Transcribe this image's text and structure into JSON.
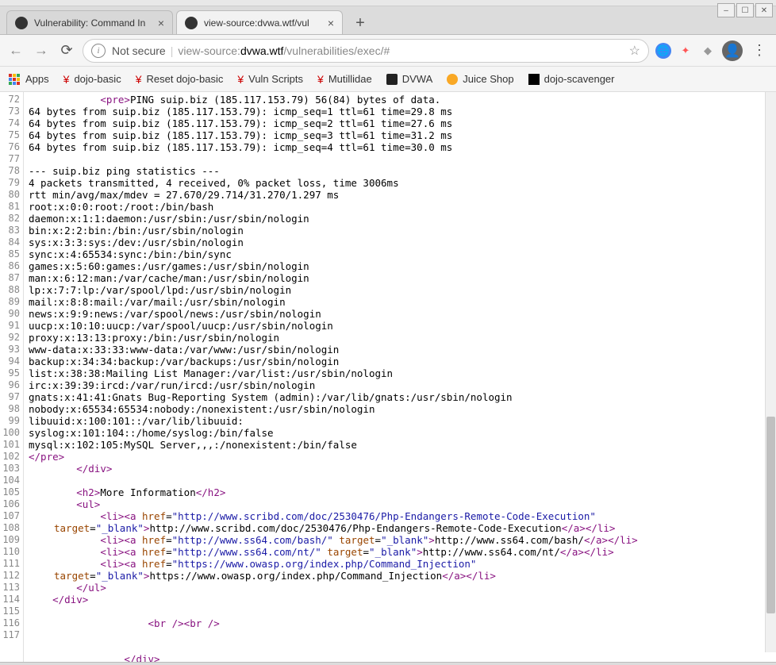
{
  "window": {
    "minimize": "–",
    "maximize": "☐",
    "close": "✕"
  },
  "tabs": {
    "tab1": "Vulnerability: Command In",
    "tab2": "view-source:dvwa.wtf/vul",
    "plus": "+"
  },
  "toolbar": {
    "not_secure": "Not secure",
    "url_prefix": "view-source:",
    "url_host": "dvwa.wtf",
    "url_path": "/vulnerabilities/exec/#"
  },
  "bookmarks": {
    "apps": "Apps",
    "dojo_basic": "dojo-basic",
    "reset_dojo": "Reset dojo-basic",
    "vuln_scripts": "Vuln Scripts",
    "mutillidae": "Mutillidae",
    "dvwa": "DVWA",
    "juice": "Juice Shop",
    "scavenger": "dojo-scavenger"
  },
  "lines": [
    {
      "n": "72",
      "indent": "            ",
      "parts": [
        {
          "k": "t",
          "v": "<pre>"
        },
        {
          "k": "x",
          "v": "PING suip.biz (185.117.153.79) 56(84) bytes of data."
        }
      ]
    },
    {
      "n": "73",
      "indent": "",
      "parts": [
        {
          "k": "x",
          "v": "64 bytes from suip.biz (185.117.153.79): icmp_seq=1 ttl=61 time=29.8 ms"
        }
      ]
    },
    {
      "n": "74",
      "indent": "",
      "parts": [
        {
          "k": "x",
          "v": "64 bytes from suip.biz (185.117.153.79): icmp_seq=2 ttl=61 time=27.6 ms"
        }
      ]
    },
    {
      "n": "75",
      "indent": "",
      "parts": [
        {
          "k": "x",
          "v": "64 bytes from suip.biz (185.117.153.79): icmp_seq=3 ttl=61 time=31.2 ms"
        }
      ]
    },
    {
      "n": "76",
      "indent": "",
      "parts": [
        {
          "k": "x",
          "v": "64 bytes from suip.biz (185.117.153.79): icmp_seq=4 ttl=61 time=30.0 ms"
        }
      ]
    },
    {
      "n": "77",
      "indent": "",
      "parts": []
    },
    {
      "n": "78",
      "indent": "",
      "parts": [
        {
          "k": "x",
          "v": "--- suip.biz ping statistics ---"
        }
      ]
    },
    {
      "n": "79",
      "indent": "",
      "parts": [
        {
          "k": "x",
          "v": "4 packets transmitted, 4 received, 0% packet loss, time 3006ms"
        }
      ]
    },
    {
      "n": "80",
      "indent": "",
      "parts": [
        {
          "k": "x",
          "v": "rtt min/avg/max/mdev = 27.670/29.714/31.270/1.297 ms"
        }
      ]
    },
    {
      "n": "81",
      "indent": "",
      "parts": [
        {
          "k": "x",
          "v": "root:x:0:0:root:/root:/bin/bash"
        }
      ]
    },
    {
      "n": "82",
      "indent": "",
      "parts": [
        {
          "k": "x",
          "v": "daemon:x:1:1:daemon:/usr/sbin:/usr/sbin/nologin"
        }
      ]
    },
    {
      "n": "83",
      "indent": "",
      "parts": [
        {
          "k": "x",
          "v": "bin:x:2:2:bin:/bin:/usr/sbin/nologin"
        }
      ]
    },
    {
      "n": "84",
      "indent": "",
      "parts": [
        {
          "k": "x",
          "v": "sys:x:3:3:sys:/dev:/usr/sbin/nologin"
        }
      ]
    },
    {
      "n": "85",
      "indent": "",
      "parts": [
        {
          "k": "x",
          "v": "sync:x:4:65534:sync:/bin:/bin/sync"
        }
      ]
    },
    {
      "n": "86",
      "indent": "",
      "parts": [
        {
          "k": "x",
          "v": "games:x:5:60:games:/usr/games:/usr/sbin/nologin"
        }
      ]
    },
    {
      "n": "87",
      "indent": "",
      "parts": [
        {
          "k": "x",
          "v": "man:x:6:12:man:/var/cache/man:/usr/sbin/nologin"
        }
      ]
    },
    {
      "n": "88",
      "indent": "",
      "parts": [
        {
          "k": "x",
          "v": "lp:x:7:7:lp:/var/spool/lpd:/usr/sbin/nologin"
        }
      ]
    },
    {
      "n": "89",
      "indent": "",
      "parts": [
        {
          "k": "x",
          "v": "mail:x:8:8:mail:/var/mail:/usr/sbin/nologin"
        }
      ]
    },
    {
      "n": "90",
      "indent": "",
      "parts": [
        {
          "k": "x",
          "v": "news:x:9:9:news:/var/spool/news:/usr/sbin/nologin"
        }
      ]
    },
    {
      "n": "91",
      "indent": "",
      "parts": [
        {
          "k": "x",
          "v": "uucp:x:10:10:uucp:/var/spool/uucp:/usr/sbin/nologin"
        }
      ]
    },
    {
      "n": "92",
      "indent": "",
      "parts": [
        {
          "k": "x",
          "v": "proxy:x:13:13:proxy:/bin:/usr/sbin/nologin"
        }
      ]
    },
    {
      "n": "93",
      "indent": "",
      "parts": [
        {
          "k": "x",
          "v": "www-data:x:33:33:www-data:/var/www:/usr/sbin/nologin"
        }
      ]
    },
    {
      "n": "94",
      "indent": "",
      "parts": [
        {
          "k": "x",
          "v": "backup:x:34:34:backup:/var/backups:/usr/sbin/nologin"
        }
      ]
    },
    {
      "n": "95",
      "indent": "",
      "parts": [
        {
          "k": "x",
          "v": "list:x:38:38:Mailing List Manager:/var/list:/usr/sbin/nologin"
        }
      ]
    },
    {
      "n": "96",
      "indent": "",
      "parts": [
        {
          "k": "x",
          "v": "irc:x:39:39:ircd:/var/run/ircd:/usr/sbin/nologin"
        }
      ]
    },
    {
      "n": "97",
      "indent": "",
      "parts": [
        {
          "k": "x",
          "v": "gnats:x:41:41:Gnats Bug-Reporting System (admin):/var/lib/gnats:/usr/sbin/nologin"
        }
      ]
    },
    {
      "n": "98",
      "indent": "",
      "parts": [
        {
          "k": "x",
          "v": "nobody:x:65534:65534:nobody:/nonexistent:/usr/sbin/nologin"
        }
      ]
    },
    {
      "n": "99",
      "indent": "",
      "parts": [
        {
          "k": "x",
          "v": "libuuid:x:100:101::/var/lib/libuuid:"
        }
      ]
    },
    {
      "n": "100",
      "indent": "",
      "parts": [
        {
          "k": "x",
          "v": "syslog:x:101:104::/home/syslog:/bin/false"
        }
      ]
    },
    {
      "n": "101",
      "indent": "",
      "parts": [
        {
          "k": "x",
          "v": "mysql:x:102:105:MySQL Server,,,:/nonexistent:/bin/false"
        }
      ]
    },
    {
      "n": "102",
      "indent": "",
      "parts": [
        {
          "k": "t",
          "v": "</pre>"
        }
      ]
    },
    {
      "n": "103",
      "indent": "        ",
      "parts": [
        {
          "k": "t",
          "v": "</div>"
        }
      ]
    },
    {
      "n": "104",
      "indent": "",
      "parts": []
    },
    {
      "n": "105",
      "indent": "        ",
      "parts": [
        {
          "k": "t",
          "v": "<h2>"
        },
        {
          "k": "x",
          "v": "More Information"
        },
        {
          "k": "t",
          "v": "</h2>"
        }
      ]
    },
    {
      "n": "106",
      "indent": "        ",
      "parts": [
        {
          "k": "t",
          "v": "<ul>"
        }
      ]
    },
    {
      "n": "107",
      "indent": "            ",
      "parts": [
        {
          "k": "t",
          "v": "<li><a "
        },
        {
          "k": "a",
          "v": "href"
        },
        {
          "k": "x",
          "v": "="
        },
        {
          "k": "v",
          "v": "\"http://www.scribd.com/doc/2530476/Php-Endangers-Remote-Code-Execution\""
        },
        {
          "k": "x",
          "v": " "
        },
        {
          "k": "a",
          "v": "target"
        },
        {
          "k": "x",
          "v": "="
        },
        {
          "k": "v",
          "v": "\"_blank\""
        },
        {
          "k": "t",
          "v": ">"
        },
        {
          "k": "x",
          "v": "http://www.scribd.com/doc/2530476/Php-Endangers-Remote-Code-Execution"
        },
        {
          "k": "t",
          "v": "</a></li>"
        }
      ]
    },
    {
      "n": "108",
      "indent": "            ",
      "parts": [
        {
          "k": "t",
          "v": "<li><a "
        },
        {
          "k": "a",
          "v": "href"
        },
        {
          "k": "x",
          "v": "="
        },
        {
          "k": "v",
          "v": "\"http://www.ss64.com/bash/\""
        },
        {
          "k": "x",
          "v": " "
        },
        {
          "k": "a",
          "v": "target"
        },
        {
          "k": "x",
          "v": "="
        },
        {
          "k": "v",
          "v": "\"_blank\""
        },
        {
          "k": "t",
          "v": ">"
        },
        {
          "k": "x",
          "v": "http://www.ss64.com/bash/"
        },
        {
          "k": "t",
          "v": "</a></li>"
        }
      ]
    },
    {
      "n": "109",
      "indent": "            ",
      "parts": [
        {
          "k": "t",
          "v": "<li><a "
        },
        {
          "k": "a",
          "v": "href"
        },
        {
          "k": "x",
          "v": "="
        },
        {
          "k": "v",
          "v": "\"http://www.ss64.com/nt/\""
        },
        {
          "k": "x",
          "v": " "
        },
        {
          "k": "a",
          "v": "target"
        },
        {
          "k": "x",
          "v": "="
        },
        {
          "k": "v",
          "v": "\"_blank\""
        },
        {
          "k": "t",
          "v": ">"
        },
        {
          "k": "x",
          "v": "http://www.ss64.com/nt/"
        },
        {
          "k": "t",
          "v": "</a></li>"
        }
      ]
    },
    {
      "n": "110",
      "indent": "            ",
      "parts": [
        {
          "k": "t",
          "v": "<li><a "
        },
        {
          "k": "a",
          "v": "href"
        },
        {
          "k": "x",
          "v": "="
        },
        {
          "k": "v",
          "v": "\"https://www.owasp.org/index.php/Command_Injection\""
        },
        {
          "k": "x",
          "v": " "
        },
        {
          "k": "a",
          "v": "target"
        },
        {
          "k": "x",
          "v": "="
        },
        {
          "k": "v",
          "v": "\"_blank\""
        },
        {
          "k": "t",
          "v": ">"
        },
        {
          "k": "x",
          "v": "https://www.owasp.org/index.php/Command_Injection"
        },
        {
          "k": "t",
          "v": "</a></li>"
        }
      ]
    },
    {
      "n": "111",
      "indent": "        ",
      "parts": [
        {
          "k": "t",
          "v": "</ul>"
        }
      ]
    },
    {
      "n": "112",
      "indent": "    ",
      "parts": [
        {
          "k": "t",
          "v": "</div>"
        }
      ]
    },
    {
      "n": "113",
      "indent": "",
      "parts": []
    },
    {
      "n": "114",
      "indent": "                    ",
      "parts": [
        {
          "k": "t",
          "v": "<br /><br />"
        }
      ]
    },
    {
      "n": "115",
      "indent": "",
      "parts": []
    },
    {
      "n": "116",
      "indent": "",
      "parts": []
    },
    {
      "n": "117",
      "indent": "                ",
      "parts": [
        {
          "k": "t",
          "v": "</div>"
        }
      ]
    }
  ]
}
